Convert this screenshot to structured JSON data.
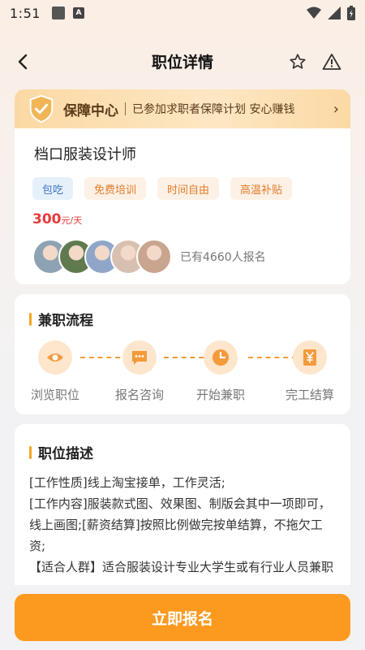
{
  "status_bar": {
    "time": "1:51",
    "badge_letter": "A"
  },
  "header": {
    "title": "职位详情",
    "icons": [
      "back-arrow-icon",
      "star-icon",
      "warning-icon"
    ]
  },
  "guarantee": {
    "title": "保障中心",
    "description": "已参加求职者保障计划 安心赚钱",
    "arrow": "›"
  },
  "job": {
    "title": "档口服装设计师",
    "tags": [
      {
        "label": "包吃",
        "style": "blue"
      },
      {
        "label": "免费培训",
        "style": "orange"
      },
      {
        "label": "时间自由",
        "style": "orange"
      },
      {
        "label": "高温补贴",
        "style": "orange"
      }
    ],
    "salary": "300",
    "salary_unit": "元/天",
    "applicants": "已有4660人报名",
    "avatar_colors": [
      "#8da2b3",
      "#5f7a4e",
      "#8fa6c9",
      "#d8c0b0",
      "#c9a48e"
    ]
  },
  "process": {
    "title": "兼职流程",
    "steps": [
      {
        "label": "浏览职位",
        "icon": "eye-icon"
      },
      {
        "label": "报名咨询",
        "icon": "chat-icon"
      },
      {
        "label": "开始兼职",
        "icon": "clock-icon"
      },
      {
        "label": "完工结算",
        "icon": "yuan-icon"
      }
    ]
  },
  "description": {
    "title": "职位描述",
    "lines": [
      "[工作性质]线上淘宝接单，工作灵活;",
      "[工作内容]服装款式图、效果图、制版会其中一项即可，线上画图;[薪资结算]按照比例做完按单结算，不拖欠工资;",
      "【适合人群】适合服装设计专业大学生或有行业人员兼职"
    ]
  },
  "apply_button": "立即报名",
  "colors": {
    "accent": "#fb9a1f",
    "price": "#e83b3b",
    "section_bar": "#f5a623",
    "tag_blue": "#3a76c6",
    "tag_orange": "#e07c2c"
  }
}
